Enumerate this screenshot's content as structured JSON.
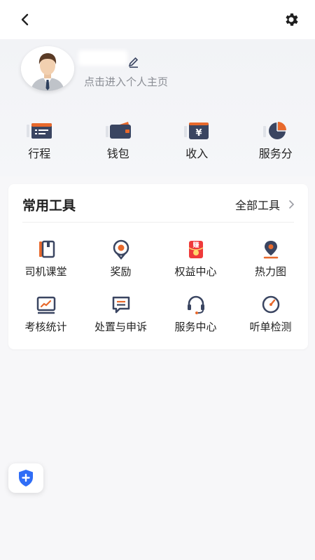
{
  "header": {
    "back_icon": "chevron-left-icon",
    "settings_icon": "gear-icon"
  },
  "profile": {
    "subtitle": "点击进入个人主页",
    "edit_icon": "pencil-icon"
  },
  "quick_actions": [
    {
      "label": "行程",
      "icon": "itinerary-icon"
    },
    {
      "label": "钱包",
      "icon": "wallet-icon"
    },
    {
      "label": "收入",
      "icon": "income-icon"
    },
    {
      "label": "服务分",
      "icon": "service-score-icon"
    }
  ],
  "tools": {
    "title": "常用工具",
    "all_label": "全部工具",
    "items": [
      {
        "label": "司机课堂",
        "icon": "book-icon"
      },
      {
        "label": "奖励",
        "icon": "medal-icon"
      },
      {
        "label": "权益中心",
        "icon": "red-envelope-icon",
        "badge": "赚"
      },
      {
        "label": "热力图",
        "icon": "location-pin-icon"
      },
      {
        "label": "考核统计",
        "icon": "chart-board-icon"
      },
      {
        "label": "处置与申诉",
        "icon": "message-icon"
      },
      {
        "label": "服务中心",
        "icon": "headset-icon"
      },
      {
        "label": "听单检测",
        "icon": "gauge-icon"
      }
    ]
  },
  "colors": {
    "accent_orange": "#e8692c",
    "icon_navy": "#3a4561",
    "shield_blue": "#2f6df6"
  },
  "fab": {
    "icon": "shield-plus-icon"
  }
}
